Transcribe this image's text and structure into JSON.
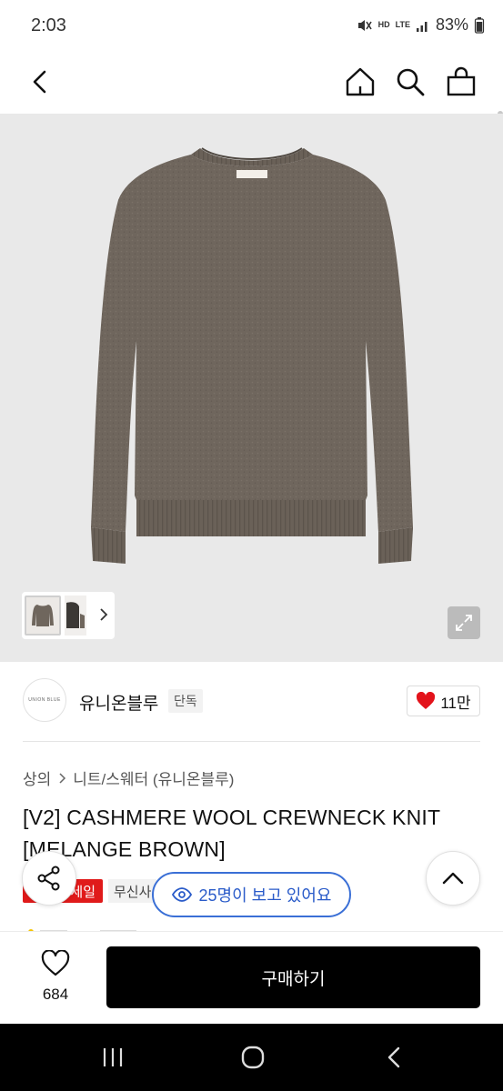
{
  "status_bar": {
    "time": "2:03",
    "network_hd": "HD",
    "network_lte": "LTE",
    "battery": "83%"
  },
  "brand": {
    "logo_text": "UNION BLUE",
    "name": "유니온블루",
    "badge": "단독",
    "like_count": "11만"
  },
  "breadcrumb": {
    "items": [
      "상의",
      "니트/스웨터 (유니온블루)"
    ]
  },
  "product": {
    "title": "[V2] CASHMERE WOOL CREWNECK KNIT [MELANGE BROWN]",
    "sale_badge": "세일",
    "store_badge": "무신사"
  },
  "viewers": {
    "text": "25명이 보고 있어요"
  },
  "bottom": {
    "wish_count": "684",
    "buy_label": "구매하기"
  },
  "colors": {
    "accent_blue": "#2a5bc9",
    "sale_red": "#e01a1a",
    "like_red": "#e3131b",
    "sweater_brown": "#6f665d"
  },
  "icons": {
    "back": "back-arrow-icon",
    "home": "home-icon",
    "search": "search-icon",
    "cart": "shopping-bag-icon",
    "share": "share-icon",
    "up": "chevron-up-icon",
    "heart": "heart-icon",
    "eye": "eye-icon",
    "expand": "expand-icon"
  }
}
